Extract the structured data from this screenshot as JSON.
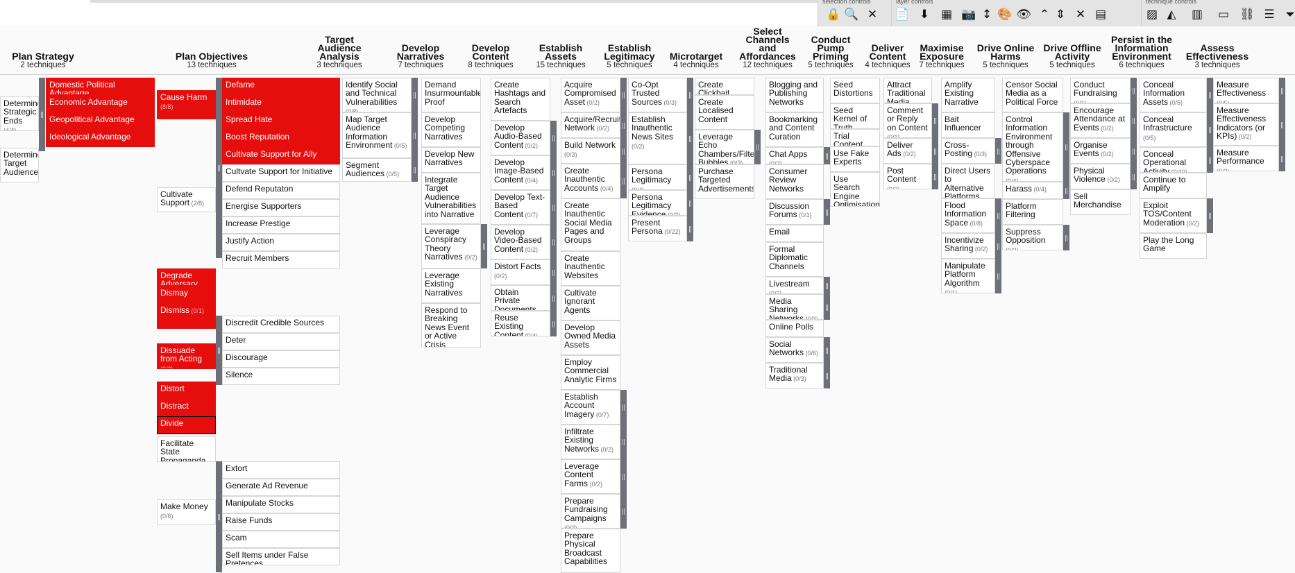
{
  "toolbar": {
    "groups": [
      {
        "label": "selection controls",
        "icons": [
          "lock-icon",
          "search-icon",
          "close-icon"
        ]
      },
      {
        "label": "layer controls",
        "icons": [
          "document-icon",
          "download-icon",
          "grid-icon",
          "camera-icon",
          "sort-icon",
          "palette-icon",
          "eye-icon",
          "expand-icon",
          "collapse-icon",
          "shrink-icon",
          "layout-icon"
        ]
      },
      {
        "label": "technique controls",
        "icons": [
          "stripes-icon",
          "fill-color-icon",
          "chart-icon",
          "comment-icon",
          "link-icon",
          "list-icon",
          "filter-icon"
        ]
      }
    ],
    "glyphs": {
      "lock-icon": "🔒",
      "search-icon": "🔍",
      "close-icon": "✕",
      "document-icon": "📄",
      "download-icon": "⬇",
      "grid-icon": "▦",
      "camera-icon": "📷",
      "sort-icon": "↕",
      "palette-icon": "🎨",
      "eye-icon": "👁",
      "expand-icon": "⌃",
      "collapse-icon": "⇕",
      "shrink-icon": "✕",
      "layout-icon": "▤",
      "stripes-icon": "▨",
      "fill-color-icon": "◭",
      "chart-icon": "▥",
      "comment-icon": "▭",
      "link-icon": "⛓",
      "list-icon": "☰",
      "filter-icon": "⏷"
    }
  },
  "colors": {
    "selected": "#e60d0d",
    "bar": "#6e7079"
  },
  "columns": [
    {
      "title": "Plan Strategy",
      "count": "2 techniques"
    },
    {
      "title": "Plan Objectives",
      "count": "13 techniques"
    },
    {
      "title": "Target Audience Analysis",
      "count": "3 techniques"
    },
    {
      "title": "Develop Narratives",
      "count": "7 techniques"
    },
    {
      "title": "Develop Content",
      "count": "8 techniques"
    },
    {
      "title": "Establish Assets",
      "count": "15 techniques"
    },
    {
      "title": "Establish Legitimacy",
      "count": "5 techniques"
    },
    {
      "title": "Microtarget",
      "count": "4 techniques"
    },
    {
      "title": "Select Channels and Affordances",
      "count": "12 techniques"
    },
    {
      "title": "Conduct Pump Priming",
      "count": "5 techniques"
    },
    {
      "title": "Deliver Content",
      "count": "4 techniques"
    },
    {
      "title": "Maximise Exposure",
      "count": "7 techniques"
    },
    {
      "title": "Drive Online Harms",
      "count": "5 techniques"
    },
    {
      "title": "Drive Offline Activity",
      "count": "5 techniques"
    },
    {
      "title": "Persist in the Information Environment",
      "count": "6 techniques"
    },
    {
      "title": "Assess Effectiveness",
      "count": "3 techniques"
    }
  ],
  "cells": {
    "c0": [
      {
        "label": "Determine Strategic Ends",
        "sub": "(4/4)"
      },
      {
        "label": "Determine Target Audiences",
        "sub": ""
      }
    ],
    "c0s": [
      {
        "label": "Domestic Political Advantage",
        "sub": ""
      },
      {
        "label": "Economic Advantage",
        "sub": ""
      },
      {
        "label": "Geopolitical Advantage",
        "sub": ""
      },
      {
        "label": "Ideological Advantage",
        "sub": ""
      }
    ],
    "c1": [
      {
        "label": "Cause Harm",
        "sub": "(8/8)"
      },
      {
        "label": "Cultivate Support",
        "sub": "(2/8)"
      },
      {
        "label": "Degrade Adversary",
        "sub": ""
      },
      {
        "label": "Dismay",
        "sub": ""
      },
      {
        "label": "Dismiss",
        "sub": "(0/1)"
      },
      {
        "label": "Dissuade from Acting",
        "sub": "(3/3)"
      },
      {
        "label": "Distort",
        "sub": ""
      },
      {
        "label": "Distract",
        "sub": ""
      },
      {
        "label": "Divide",
        "sub": ""
      },
      {
        "label": "Facilitate State Propaganda",
        "sub": ""
      },
      {
        "label": "Make Money",
        "sub": "(0/6)"
      }
    ],
    "c1s": [
      {
        "label": "Defame",
        "sub": ""
      },
      {
        "label": "Intimidate",
        "sub": ""
      },
      {
        "label": "Spread Hate",
        "sub": ""
      },
      {
        "label": "Boost Reputation",
        "sub": ""
      },
      {
        "label": "Cultivate Support for Ally",
        "sub": ""
      },
      {
        "label": "Cultvate Support for Initiative",
        "sub": ""
      },
      {
        "label": "Defend Reputaton",
        "sub": ""
      },
      {
        "label": "Energise Supporters",
        "sub": ""
      },
      {
        "label": "Increase Prestige",
        "sub": ""
      },
      {
        "label": "Justify Action",
        "sub": ""
      },
      {
        "label": "Recruit Members",
        "sub": ""
      },
      {
        "label": "Discredit Credible Sources",
        "sub": ""
      },
      {
        "label": "Deter",
        "sub": ""
      },
      {
        "label": "Discourage",
        "sub": ""
      },
      {
        "label": "Silence",
        "sub": ""
      },
      {
        "label": "Extort",
        "sub": ""
      },
      {
        "label": "Generate Ad Revenue",
        "sub": ""
      },
      {
        "label": "Manipulate Stocks",
        "sub": ""
      },
      {
        "label": "Raise Funds",
        "sub": ""
      },
      {
        "label": "Scam",
        "sub": ""
      },
      {
        "label": "Sell Items under False Pretences",
        "sub": ""
      }
    ],
    "c2": [
      {
        "label": "Identify Social and Technical Vulnerabilities",
        "sub": "(0/8)"
      },
      {
        "label": "Map Target Audience Information Environment",
        "sub": "(0/5)"
      },
      {
        "label": "Segment Audiences",
        "sub": "(0/5)"
      }
    ],
    "c3": [
      {
        "label": "Demand Insurmountable Proof",
        "sub": ""
      },
      {
        "label": "Develop Competing Narratives",
        "sub": ""
      },
      {
        "label": "Develop New Narratives",
        "sub": ""
      },
      {
        "label": "Integrate Target Audience Vulnerabilities into Narrative",
        "sub": ""
      },
      {
        "label": "Leverage Conspiracy Theory Narratives",
        "sub": "(0/2)"
      },
      {
        "label": "Leverage Existing Narratives",
        "sub": ""
      },
      {
        "label": "Respond to Breaking News Event or Active Crisis",
        "sub": ""
      }
    ],
    "c4": [
      {
        "label": "Create Hashtags and Search Artefacts",
        "sub": ""
      },
      {
        "label": "Develop Audio-Based Content",
        "sub": "(0/2)"
      },
      {
        "label": "Develop Image-Based Content",
        "sub": "(0/4)"
      },
      {
        "label": "Develop Text-Based Content",
        "sub": "(0/7)"
      },
      {
        "label": "Develop Video-Based Content",
        "sub": "(0/2)"
      },
      {
        "label": "Distort Facts",
        "sub": "(0/2)"
      },
      {
        "label": "Obtain Private Documents",
        "sub": "(0/2)"
      },
      {
        "label": "Reuse Existing Content",
        "sub": "(0/4)"
      }
    ],
    "c5": [
      {
        "label": "Acquire Compromised Asset",
        "sub": "(0/2)"
      },
      {
        "label": "Acquire/Recruit Network",
        "sub": "(0/2)"
      },
      {
        "label": "Build Network",
        "sub": "(0/3)"
      },
      {
        "label": "Create Inauthentic Accounts",
        "sub": "(0/4)"
      },
      {
        "label": "Create Inauthentic Social Media Pages and Groups",
        "sub": ""
      },
      {
        "label": "Create Inauthentic Websites",
        "sub": ""
      },
      {
        "label": "Cultivate Ignorant Agents",
        "sub": ""
      },
      {
        "label": "Develop Owned Media Assets",
        "sub": ""
      },
      {
        "label": "Employ Commercial Analytic Firms",
        "sub": ""
      },
      {
        "label": "Establish Account Imagery",
        "sub": "(0/7)"
      },
      {
        "label": "Infiltrate Existing Networks",
        "sub": "(0/2)"
      },
      {
        "label": "Leverage Content Farms",
        "sub": "(0/2)"
      },
      {
        "label": "Prepare Fundraising Campaigns",
        "sub": "(0/2)"
      },
      {
        "label": "Prepare Physical Broadcast Capabilities",
        "sub": ""
      }
    ],
    "c6": [
      {
        "label": "Co-Opt Trusted Sources",
        "sub": "(0/3)"
      },
      {
        "label": "Establish Inauthentic News Sites",
        "sub": "(0/2)"
      },
      {
        "label": "Persona Legitimacy",
        "sub": "(0/4)"
      },
      {
        "label": "Persona Legitimacy Evidence",
        "sub": "(0/2)"
      },
      {
        "label": "Present Persona",
        "sub": "(0/22)"
      }
    ],
    "c7": [
      {
        "label": "Create Clickbait",
        "sub": ""
      },
      {
        "label": "Create Localised Content",
        "sub": ""
      },
      {
        "label": "Leverage Echo Chambers/Filter Bubbles",
        "sub": "(0/3)"
      },
      {
        "label": "Purchase Targeted Advertisements",
        "sub": ""
      }
    ],
    "c8": [
      {
        "label": "Blogging and Publishing Networks",
        "sub": ""
      },
      {
        "label": "Bookmarking and Content Curation",
        "sub": ""
      },
      {
        "label": "Chat Apps",
        "sub": "(0/2)"
      },
      {
        "label": "Consumer Review Networks",
        "sub": ""
      },
      {
        "label": "Discussion Forums",
        "sub": "(0/1)"
      },
      {
        "label": "Email",
        "sub": ""
      },
      {
        "label": "Formal Diplomatic Channels",
        "sub": ""
      },
      {
        "label": "Livestream",
        "sub": "(0/2)"
      },
      {
        "label": "Media Sharing Networks",
        "sub": "(0/3)"
      },
      {
        "label": "Online Polls",
        "sub": ""
      },
      {
        "label": "Social Networks",
        "sub": "(0/6)"
      },
      {
        "label": "Traditional Media",
        "sub": "(0/3)"
      }
    ],
    "c9": [
      {
        "label": "Seed Distortions",
        "sub": ""
      },
      {
        "label": "Seed Kernel of Truth",
        "sub": ""
      },
      {
        "label": "Trial Content",
        "sub": ""
      },
      {
        "label": "Use Fake Experts",
        "sub": ""
      },
      {
        "label": "Use Search Engine Optimisation",
        "sub": ""
      }
    ],
    "c10": [
      {
        "label": "Attract Traditional Media",
        "sub": ""
      },
      {
        "label": "Comment or Reply on Content",
        "sub": "(0/1)"
      },
      {
        "label": "Deliver Ads",
        "sub": "(0/2)"
      },
      {
        "label": "Post Content",
        "sub": "(0/3)"
      }
    ],
    "c11": [
      {
        "label": "Amplify Existing Narrative",
        "sub": ""
      },
      {
        "label": "Bait Influencer",
        "sub": ""
      },
      {
        "label": "Cross-Posting",
        "sub": "(0/3)"
      },
      {
        "label": "Direct Users to Alternative Platforms",
        "sub": ""
      },
      {
        "label": "Flood Information Space",
        "sub": "(0/8)"
      },
      {
        "label": "Incentivize Sharing",
        "sub": "(0/2)"
      },
      {
        "label": "Manipulate Platform Algorithm",
        "sub": "(0/1)"
      }
    ],
    "c12": [
      {
        "label": "Censor Social Media as a Political Force",
        "sub": ""
      },
      {
        "label": "Control Information Environment through Offensive Cyberspace Operations",
        "sub": "(0/4)"
      },
      {
        "label": "Harass",
        "sub": "(0/4)"
      },
      {
        "label": "Platform Filtering",
        "sub": ""
      },
      {
        "label": "Suppress Opposition",
        "sub": "(0/3)"
      }
    ],
    "c13": [
      {
        "label": "Conduct Fundraising",
        "sub": "(0/1)"
      },
      {
        "label": "Encourage Attendance at Events",
        "sub": "(0/2)"
      },
      {
        "label": "Organise Events",
        "sub": "(0/2)"
      },
      {
        "label": "Physical Violence",
        "sub": "(0/2)"
      },
      {
        "label": "Sell Merchandise",
        "sub": ""
      }
    ],
    "c14": [
      {
        "label": "Conceal Information Assets",
        "sub": "(0/5)"
      },
      {
        "label": "Conceal Infrastructure",
        "sub": "(0/5)"
      },
      {
        "label": "Conceal Operational Activity",
        "sub": "(0/10)"
      },
      {
        "label": "Continue to Amplify",
        "sub": ""
      },
      {
        "label": "Exploit TOS/Content Moderation",
        "sub": "(0/2)"
      },
      {
        "label": "Play the Long Game",
        "sub": ""
      }
    ],
    "c15": [
      {
        "label": "Measure Effectiveness",
        "sub": "(0/5)"
      },
      {
        "label": "Measure Effectiveness Indicators (or KPIs)",
        "sub": "(0/2)"
      },
      {
        "label": "Measure Performance",
        "sub": "(0/3)"
      }
    ]
  }
}
